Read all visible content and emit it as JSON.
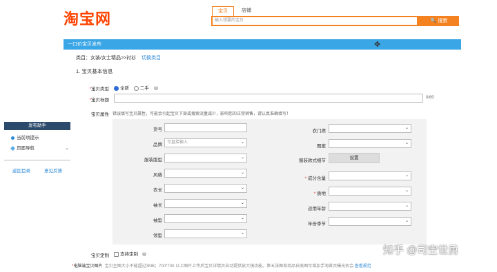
{
  "header": {
    "logo": "淘宝网",
    "tab_active": "宝贝",
    "tab_inactive": "店铺",
    "search_placeholder": "输入想要的宝贝",
    "search_button": "搜索"
  },
  "titlebar": {
    "title": "一口价宝贝发布"
  },
  "category": {
    "text": "类目：女装/女士精品>>衬衫",
    "switch": "切换类目"
  },
  "section": {
    "title": "1. 宝贝基本信息"
  },
  "basic": {
    "type_label": "宝贝类型",
    "opt_new": "全新",
    "opt_used": "二手",
    "title_label": "宝贝标题",
    "title_count": "0/60",
    "attr_label": "宝贝属性",
    "attr_notice": "错误填写宝贝属性，可能会引起宝贝下架或搜索流量减少，影响您的正常销售，请认真准确填写！"
  },
  "attrs_left": [
    {
      "label": "货号",
      "kind": "input",
      "value": ""
    },
    {
      "label": "品牌",
      "kind": "select",
      "value": "可直接输入"
    },
    {
      "label": "服装版型",
      "kind": "select",
      "value": ""
    },
    {
      "label": "风格",
      "kind": "select",
      "value": ""
    },
    {
      "label": "衣长",
      "kind": "select",
      "value": ""
    },
    {
      "label": "袖长",
      "kind": "select",
      "value": ""
    },
    {
      "label": "袖型",
      "kind": "select",
      "value": ""
    },
    {
      "label": "领型",
      "kind": "select",
      "value": ""
    }
  ],
  "attrs_right": [
    {
      "label": "衣门襟",
      "kind": "select",
      "required": false
    },
    {
      "label": "图案",
      "kind": "select",
      "required": false
    },
    {
      "label": "服装款式细节",
      "kind": "button",
      "button": "设置",
      "required": false
    },
    {
      "label": "成分含量",
      "kind": "select",
      "required": true
    },
    {
      "label": "质地",
      "kind": "select",
      "required": true
    },
    {
      "label": "适用年龄",
      "kind": "select",
      "required": false
    },
    {
      "label": "年份季节",
      "kind": "select",
      "required": false
    }
  ],
  "custom": {
    "label": "宝贝定制",
    "option": "支持定制"
  },
  "mobile": {
    "label": "电脑端宝贝图片",
    "note": "宝贝主图大小不能超过3MB；700*700 以上图片上传后宝贝详情页自动提供放大镜功能。第五张图发商品白底图可增加手淘首页曝光机会",
    "link": "查看规范"
  },
  "sidebar": {
    "head": "发布助手",
    "item1": "当前项提示",
    "item2": "页面导航",
    "link1": "返回目录",
    "link2": "意见反馈"
  },
  "watermark": "知乎 @司空世勇"
}
